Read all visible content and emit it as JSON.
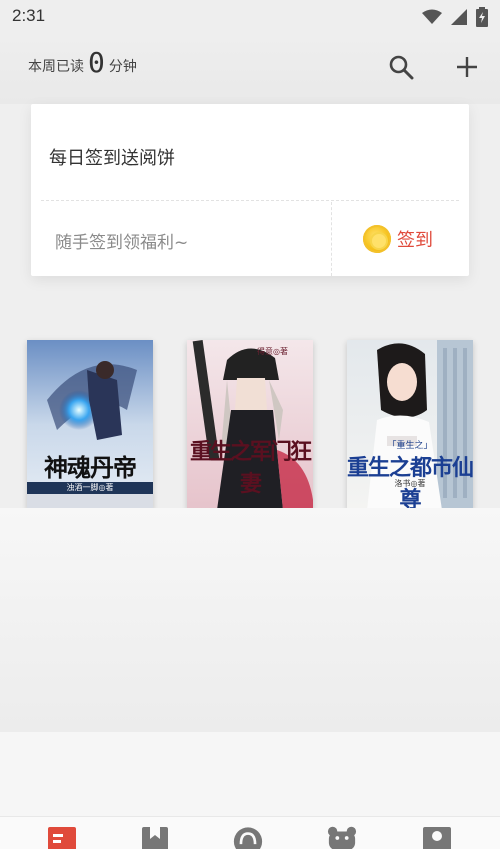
{
  "status_bar": {
    "time": "2:31",
    "icons": [
      "wifi-icon",
      "cellular-signal-icon",
      "battery-charging-icon"
    ]
  },
  "header": {
    "weekly_prefix": "本周已读",
    "weekly_minutes": "0",
    "weekly_suffix": "分钟",
    "actions": [
      "search-icon",
      "add-icon"
    ]
  },
  "signin_card": {
    "title": "每日签到送阅饼",
    "subtitle": "随手签到领福利~",
    "button_label": "签到",
    "accent_color": "#e04a3b",
    "coin_icon": "coin-icon"
  },
  "books": [
    {
      "title": "神魂丹帝",
      "author": "浊酒一脚◎著"
    },
    {
      "title": "重生之军门狂妻",
      "author": "得意◎著"
    },
    {
      "title": "重生之都市仙尊",
      "author": "洛书◎著"
    }
  ],
  "bottom_nav": {
    "items": [
      {
        "icon": "bookshelf-icon",
        "active": true
      },
      {
        "icon": "bookmark-icon",
        "active": false
      },
      {
        "icon": "headphones-icon",
        "active": false
      },
      {
        "icon": "bear-icon",
        "active": false
      },
      {
        "icon": "profile-icon",
        "active": false
      }
    ],
    "active_color": "#e04a3b",
    "inactive_color": "#777777"
  }
}
